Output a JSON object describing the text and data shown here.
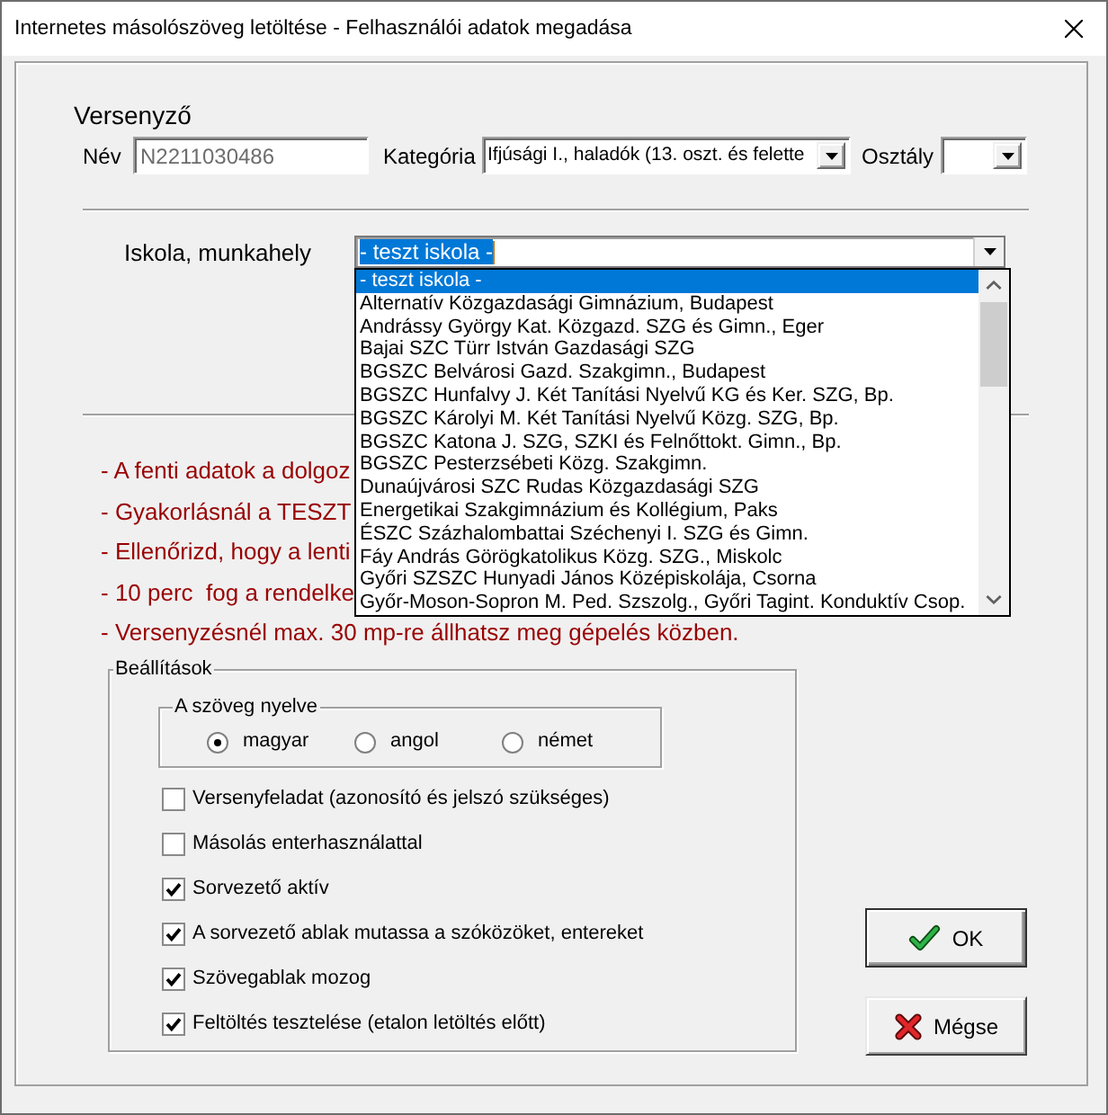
{
  "window": {
    "title": "Internetes másolószöveg letöltése - Felhasználói adatok megadása"
  },
  "competitor": {
    "heading": "Versenyző",
    "name": {
      "label": "Név",
      "value": "N2211030486",
      "disabled": true
    },
    "category": {
      "label": "Kategória",
      "value": "Ifjúsági I., haladók (13. oszt. és felette"
    },
    "class": {
      "label": "Osztály"
    }
  },
  "school": {
    "label": "Iskola, munkahely",
    "value": "- teszt iskola -",
    "focused": true,
    "options": [
      {
        "label": "- teszt iskola -",
        "selected": true
      },
      {
        "label": "Alternatív Közgazdasági Gimnázium, Budapest",
        "selected": false
      },
      {
        "label": "Andrássy György Kat. Közgazd. SZG és Gimn., Eger",
        "selected": false
      },
      {
        "label": "Bajai SZC Türr István Gazdasági SZG",
        "selected": false
      },
      {
        "label": "BGSZC Belvárosi Gazd. Szakgimn., Budapest",
        "selected": false
      },
      {
        "label": "BGSZC Hunfalvy J. Két Tanítási Nyelvű KG és Ker. SZG, Bp.",
        "selected": false
      },
      {
        "label": "BGSZC Károlyi M. Két Tanítási Nyelvű Közg. SZG, Bp.",
        "selected": false
      },
      {
        "label": "BGSZC Katona J. SZG, SZKI és Felnőttokt. Gimn., Bp.",
        "selected": false
      },
      {
        "label": "BGSZC Pesterzsébeti Közg. Szakgimn.",
        "selected": false
      },
      {
        "label": "Dunaújvárosi SZC Rudas Közgazdasági SZG",
        "selected": false
      },
      {
        "label": "Energetikai Szakgimnázium és Kollégium, Paks",
        "selected": false
      },
      {
        "label": "ÉSZC Százhalombattai Széchenyi I. SZG és Gimn.",
        "selected": false
      },
      {
        "label": "Fáy András Görögkatolikus Közg. SZG., Miskolc",
        "selected": false
      },
      {
        "label": "Győri SZSZC Hunyadi János Középiskolája, Csorna",
        "selected": false
      },
      {
        "label": "Győr-Moson-Sopron M. Ped. Szszolg., Győri Tagint. Konduktív Csop.",
        "selected": false
      }
    ]
  },
  "notes": [
    "- A fenti adatok a dolgoz",
    "- Gyakorlásnál a TESZT",
    "- Ellenőrizd, hogy a lenti",
    "- 10 perc  fog a rendelke",
    "- Versenyzésnél max. 30 mp-re állhatsz meg gépelés közben."
  ],
  "settings": {
    "title": "Beállítások",
    "language": {
      "title": "A szöveg nyelve",
      "options": [
        {
          "label": "magyar",
          "selected": true
        },
        {
          "label": "angol",
          "selected": false
        },
        {
          "label": "német",
          "selected": false
        }
      ]
    },
    "checkboxes": [
      {
        "label": "Versenyfeladat (azonosító és jelszó szükséges)",
        "checked": false
      },
      {
        "label": "Másolás enterhasználattal",
        "checked": false
      },
      {
        "label": "Sorvezető aktív",
        "checked": true
      },
      {
        "label": "A sorvezető ablak mutassa a szóközöket, entereket",
        "checked": true
      },
      {
        "label": "Szövegablak mozog",
        "checked": true
      },
      {
        "label": "Feltöltés tesztelése (etalon letöltés előtt)",
        "checked": true
      }
    ]
  },
  "buttons": [
    {
      "kind": "ok",
      "label": "OK",
      "default": true
    },
    {
      "kind": "cancel",
      "label": "Mégse",
      "default": false
    }
  ]
}
